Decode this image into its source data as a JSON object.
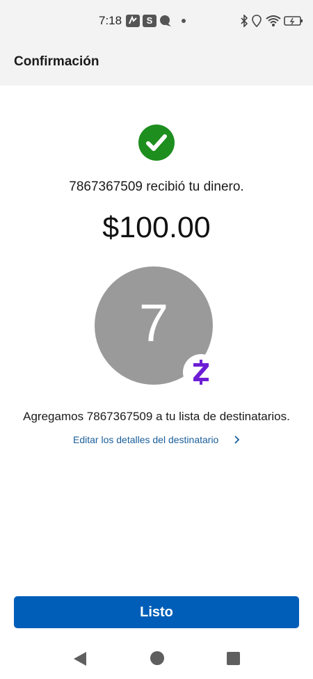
{
  "status_bar": {
    "time": "7:18",
    "icons": [
      "zelle-notification-icon",
      "s-app-icon",
      "chat-bubble-icon",
      "notification-dot",
      "bluetooth-icon",
      "location-icon",
      "wifi-icon",
      "battery-charging-icon"
    ],
    "s_app_label": "S"
  },
  "header": {
    "title": "Confirmación"
  },
  "confirmation": {
    "icon": "check-circle-icon",
    "success_color": "#1e8e1e",
    "message": "7867367509 recibió tu dinero.",
    "amount": "$100.00",
    "avatar_letter": "7",
    "avatar_color": "#9a9a9a",
    "badge_icon": "zelle-logo-icon",
    "badge_color": "#6d1ed4",
    "added_message": "Agregamos 7867367509 a tu lista de destinatarios.",
    "edit_link": "Editar los detalles del destinatario"
  },
  "actions": {
    "done_label": "Listo",
    "done_color": "#005eb8"
  },
  "nav_bar": {
    "icons": [
      "back-icon",
      "home-icon",
      "recents-icon"
    ]
  }
}
